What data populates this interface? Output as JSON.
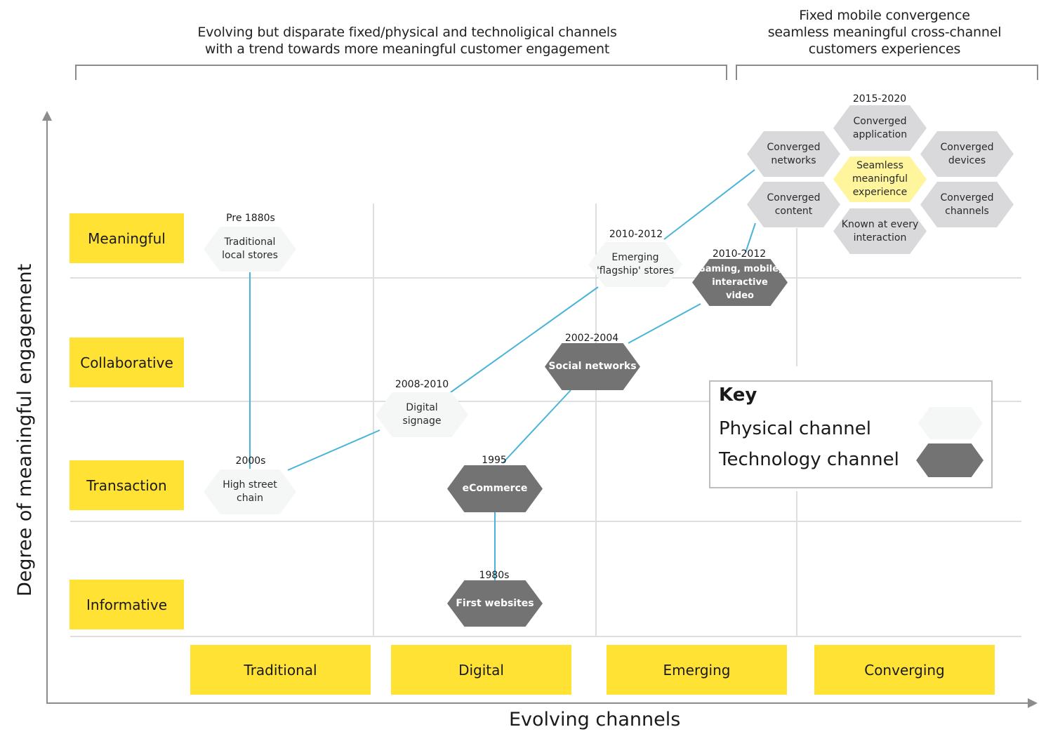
{
  "header": {
    "left_title_line1": "Evolving but disparate fixed/physical and technoligical channels",
    "left_title_line2": "with a trend towards more meaningful customer engagement",
    "right_title_line1": "Fixed mobile convergence",
    "right_title_line2": "seamless meaningful cross-channel",
    "right_title_line3": "customers experiences"
  },
  "axes": {
    "y_title": "Degree of meaningful engagement",
    "x_title": "Evolving channels",
    "y_levels": [
      "Meaningful",
      "Collaborative",
      "Transaction",
      "Informative"
    ],
    "x_stages": [
      "Traditional",
      "Digital",
      "Emerging",
      "Converging"
    ]
  },
  "colors": {
    "label_yellow": "#ffe234",
    "physical_fill": "#f5f7f7",
    "technology_fill": "#747374",
    "converged_fill": "#d9d9dc",
    "core_fill": "#fff59c",
    "connector": "#4ab4d8",
    "grid": "#dedede",
    "axis": "#8c8c8c"
  },
  "nodes": {
    "traditional_local_stores": {
      "year": "Pre 1880s",
      "label_line1": "Traditional",
      "label_line2": "local stores",
      "type": "physical",
      "stage": "Traditional",
      "level": "Meaningful"
    },
    "high_street_chain": {
      "year": "2000s",
      "label_line1": "High street",
      "label_line2": "chain",
      "type": "physical",
      "stage": "Traditional",
      "level": "Transaction"
    },
    "digital_signage": {
      "year": "2008-2010",
      "label_line1": "Digital",
      "label_line2": "signage",
      "type": "physical",
      "stage": "Digital",
      "level": "Transaction/Collaborative"
    },
    "emerging_flagship_stores": {
      "year": "2010-2012",
      "label_line1": "Emerging",
      "label_line2": "'flagship' stores",
      "type": "physical",
      "stage": "Emerging",
      "level": "Meaningful"
    },
    "first_websites": {
      "year": "1980s",
      "label_line1": "First websites",
      "type": "technology",
      "stage": "Digital",
      "level": "Informative"
    },
    "ecommerce": {
      "year": "1995",
      "label_line1": "eCommerce",
      "type": "technology",
      "stage": "Digital",
      "level": "Transaction"
    },
    "social_networks": {
      "year": "2002-2004",
      "label_line1": "Social networks",
      "type": "technology",
      "stage": "Emerging",
      "level": "Collaborative"
    },
    "gaming_mobile_video": {
      "year": "2010-2012",
      "label_line1": "Gaming, mobile,",
      "label_line2": "interactive",
      "label_line3": "video",
      "type": "technology",
      "stage": "Emerging",
      "level": "Meaningful"
    }
  },
  "convergence_cluster": {
    "year": "2015-2020",
    "core": {
      "line1": "Seamless",
      "line2": "meaningful",
      "line3": "experience"
    },
    "petals": [
      {
        "line1": "Converged",
        "line2": "application"
      },
      {
        "line1": "Converged",
        "line2": "networks"
      },
      {
        "line1": "Converged",
        "line2": "devices"
      },
      {
        "line1": "Converged",
        "line2": "content"
      },
      {
        "line1": "Converged",
        "line2": "channels"
      },
      {
        "line1": "Known at every",
        "line2": "interaction"
      }
    ]
  },
  "connections": [
    [
      "traditional_local_stores",
      "high_street_chain"
    ],
    [
      "high_street_chain",
      "digital_signage"
    ],
    [
      "digital_signage",
      "emerging_flagship_stores"
    ],
    [
      "emerging_flagship_stores",
      "converged_networks"
    ],
    [
      "first_websites",
      "ecommerce"
    ],
    [
      "ecommerce",
      "social_networks"
    ],
    [
      "social_networks",
      "gaming_mobile_video"
    ],
    [
      "gaming_mobile_video",
      "converged_content"
    ]
  ],
  "key": {
    "title": "Key",
    "physical_label": "Physical channel",
    "technology_label": "Technology channel"
  }
}
